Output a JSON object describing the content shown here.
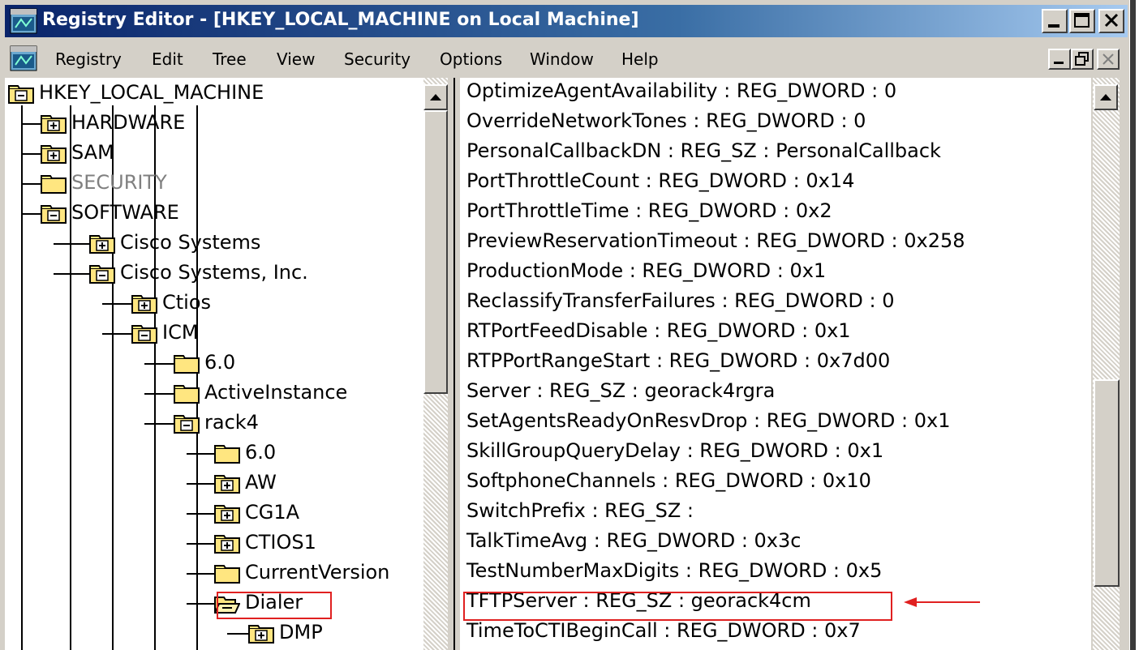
{
  "window": {
    "title": "Registry Editor - [HKEY_LOCAL_MACHINE on Local Machine]"
  },
  "menu": [
    "Registry",
    "Edit",
    "Tree",
    "View",
    "Security",
    "Options",
    "Window",
    "Help"
  ],
  "tree": [
    {
      "label": "HKEY_LOCAL_MACHINE",
      "state": "minus",
      "depth": 0
    },
    {
      "label": "HARDWARE",
      "state": "plus",
      "depth": 1
    },
    {
      "label": "SAM",
      "state": "plus",
      "depth": 1
    },
    {
      "label": "SECURITY",
      "state": "none",
      "depth": 1,
      "disabled": true
    },
    {
      "label": "SOFTWARE",
      "state": "minus",
      "depth": 1
    },
    {
      "label": "Cisco Systems",
      "state": "plus",
      "depth": 2
    },
    {
      "label": "Cisco Systems, Inc.",
      "state": "minus",
      "depth": 2
    },
    {
      "label": "Ctios",
      "state": "plus",
      "depth": 3
    },
    {
      "label": "ICM",
      "state": "minus",
      "depth": 3
    },
    {
      "label": "6.0",
      "state": "none",
      "depth": 4
    },
    {
      "label": "ActiveInstance",
      "state": "none",
      "depth": 4
    },
    {
      "label": "rack4",
      "state": "minus",
      "depth": 4
    },
    {
      "label": "6.0",
      "state": "none",
      "depth": 5
    },
    {
      "label": "AW",
      "state": "plus",
      "depth": 5
    },
    {
      "label": "CG1A",
      "state": "plus",
      "depth": 5
    },
    {
      "label": "CTIOS1",
      "state": "plus",
      "depth": 5
    },
    {
      "label": "CurrentVersion",
      "state": "none",
      "depth": 5
    },
    {
      "label": "Dialer",
      "state": "open",
      "depth": 5,
      "selected": true
    },
    {
      "label": "DMP",
      "state": "plus",
      "depth": 6
    }
  ],
  "values": [
    "OptimizeAgentAvailability : REG_DWORD : 0",
    "OverrideNetworkTones : REG_DWORD : 0",
    "PersonalCallbackDN : REG_SZ : PersonalCallback",
    "PortThrottleCount : REG_DWORD : 0x14",
    "PortThrottleTime : REG_DWORD : 0x2",
    "PreviewReservationTimeout : REG_DWORD : 0x258",
    "ProductionMode : REG_DWORD : 0x1",
    "ReclassifyTransferFailures : REG_DWORD : 0",
    "RTPortFeedDisable : REG_DWORD : 0x1",
    "RTPPortRangeStart : REG_DWORD : 0x7d00",
    "Server : REG_SZ : georack4rgra",
    "SetAgentsReadyOnResvDrop : REG_DWORD : 0x1",
    "SkillGroupQueryDelay : REG_DWORD : 0x1",
    "SoftphoneChannels : REG_DWORD : 0x10",
    "SwitchPrefix : REG_SZ :",
    "TalkTimeAvg : REG_DWORD : 0x3c",
    "TestNumberMaxDigits : REG_DWORD : 0x5",
    "TFTPServer : REG_SZ : georack4cm",
    "TimeToCTIBeginCall : REG_DWORD : 0x7"
  ],
  "highlighted_value_index": 17,
  "colors": {
    "highlight": "#e02020",
    "title_bar": "#0a246a",
    "folder": "#ffe680"
  },
  "icons": {
    "app": "registry-app-icon",
    "folder_closed": "folder-icon",
    "folder_open": "open-folder-icon",
    "expand": "plus-box-icon",
    "collapse": "minus-box-icon"
  }
}
